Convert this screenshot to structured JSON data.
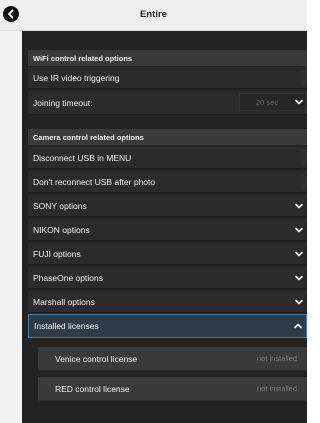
{
  "window": {
    "title": "Entire"
  },
  "sections": {
    "wifi": {
      "title": "WiFi control related options",
      "items": {
        "ir_video": {
          "label": "Use IR video triggering"
        },
        "joining_timeout": {
          "label": "Joining timeout:",
          "value": "20 sec"
        }
      }
    },
    "camera": {
      "title": "Camera control related options",
      "items": {
        "disconnect_usb": {
          "label": "Disconnect USB in MENU"
        },
        "dont_reconnect": {
          "label": "Don't reconnect USB after photo"
        },
        "sony": {
          "label": "SONY options"
        },
        "nikon": {
          "label": "NIKON options"
        },
        "fuji": {
          "label": "FUJI options"
        },
        "phaseone": {
          "label": "PhaseOne options"
        },
        "marshall": {
          "label": "Marshall options"
        },
        "licenses": {
          "label": "Installed licenses"
        }
      }
    },
    "licenses": [
      {
        "name": "Venice control license",
        "status": "not installed"
      },
      {
        "name": "RED control license",
        "status": "not installed"
      }
    ]
  },
  "colors": {
    "accent": "#3e7fb0",
    "panel": "#232323",
    "header": "#efefef"
  },
  "icons": {
    "back": "chevron-left-icon",
    "expand": "chevron-down-icon",
    "collapse": "chevron-up-icon"
  }
}
